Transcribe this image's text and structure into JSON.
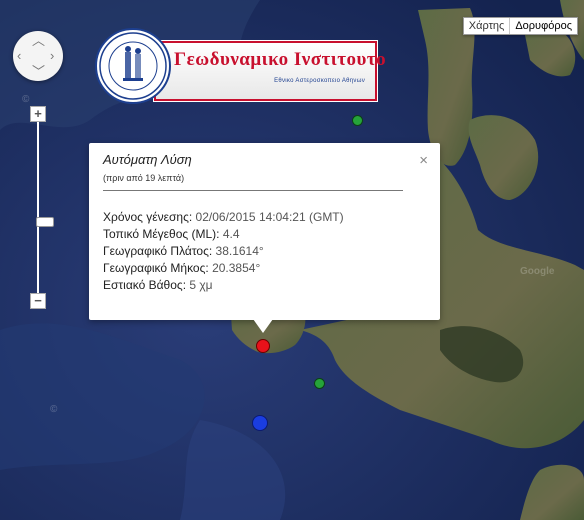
{
  "map_type": {
    "options": [
      "Χάρτης",
      "Δορυφόρος"
    ],
    "selected": "Δορυφόρος"
  },
  "logo": {
    "title": "Γεωδυναμικο Ινστιτουτο",
    "subtitle": "Εθνικο Αστεροσκοπειο Αθηνων"
  },
  "zoom": {
    "plus": "+",
    "minus": "−",
    "level_fraction": 0.57
  },
  "popup": {
    "title": "Αυτόματη Λύση",
    "subtitle": "(πριν από 19 λεπτά)",
    "close": "×",
    "rows": [
      {
        "label": "Χρόνος γένεσης:",
        "value": "02/06/2015  14:04:21 (GMT)"
      },
      {
        "label": "Τοπικό Μέγεθος (ML):",
        "value": "4.4"
      },
      {
        "label": "Γεωγραφικό Πλάτος:",
        "value": "38.1614°"
      },
      {
        "label": "Γεωγραφικό Μήκος:",
        "value": "20.3854°"
      },
      {
        "label": "Εστιακό Βάθος:",
        "value": "5 χμ"
      }
    ]
  },
  "markers": [
    {
      "name": "epicenter-red",
      "color": "#e8121a"
    },
    {
      "name": "epicenter-blue",
      "color": "#1a3de0"
    },
    {
      "name": "epicenter-green-1",
      "color": "#26a33a"
    },
    {
      "name": "epicenter-green-2",
      "color": "#26a33a"
    }
  ],
  "colors": {
    "sea": "#1c2f63",
    "land": "#4a5d3c",
    "accent": "#c8102e"
  }
}
